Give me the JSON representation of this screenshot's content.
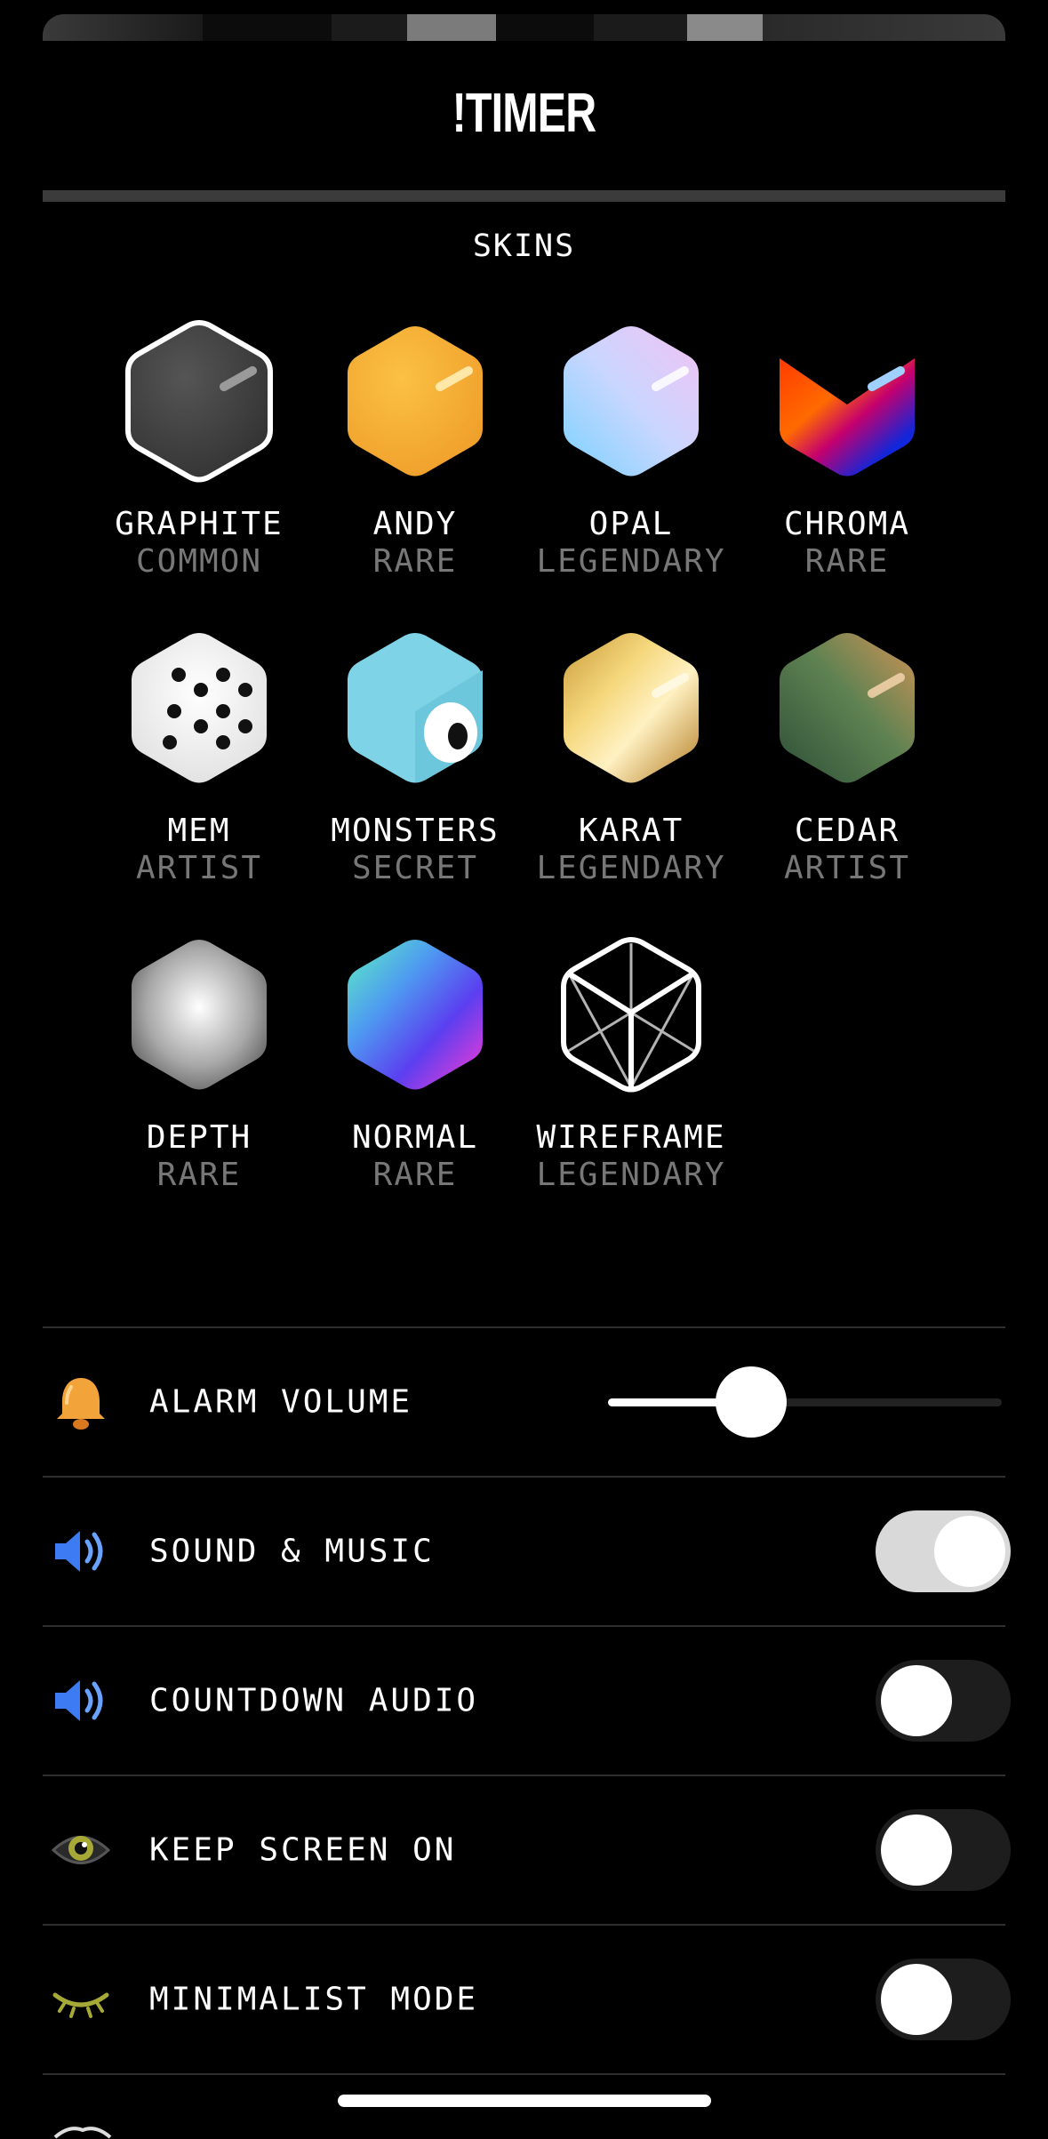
{
  "app": {
    "title": "!TIMER"
  },
  "skins_section": {
    "title": "SKINS"
  },
  "skins": [
    {
      "name": "GRAPHITE",
      "rarity": "COMMON",
      "selected": true
    },
    {
      "name": "ANDY",
      "rarity": "RARE"
    },
    {
      "name": "OPAL",
      "rarity": "LEGENDARY"
    },
    {
      "name": "CHROMA",
      "rarity": "RARE"
    },
    {
      "name": "MEM",
      "rarity": "ARTIST"
    },
    {
      "name": "MONSTERS",
      "rarity": "SECRET"
    },
    {
      "name": "KARAT",
      "rarity": "LEGENDARY"
    },
    {
      "name": "CEDAR",
      "rarity": "ARTIST"
    },
    {
      "name": "DEPTH",
      "rarity": "RARE"
    },
    {
      "name": "NORMAL",
      "rarity": "RARE"
    },
    {
      "name": "WIREFRAME",
      "rarity": "LEGENDARY"
    }
  ],
  "settings": {
    "alarm_volume": {
      "label": "ALARM VOLUME",
      "icon": "bell-icon",
      "value": 0.3
    },
    "sound_music": {
      "label": "SOUND & MUSIC",
      "icon": "speaker-icon",
      "on": true
    },
    "countdown_audio": {
      "label": "COUNTDOWN AUDIO",
      "icon": "speaker-icon",
      "on": false
    },
    "keep_screen_on": {
      "label": "KEEP SCREEN ON",
      "icon": "eye-icon",
      "on": false
    },
    "minimalist_mode": {
      "label": "MINIMALIST MODE",
      "icon": "closed-eye-icon",
      "on": false
    }
  },
  "colors": {
    "background": "#000000",
    "rarity_text": "#777777",
    "toggle_off": "#1d1d1d",
    "toggle_on": "#d9d9d9",
    "bell": "#f2a43a",
    "speaker": "#3d7bf2",
    "eye": "#a7a936"
  }
}
